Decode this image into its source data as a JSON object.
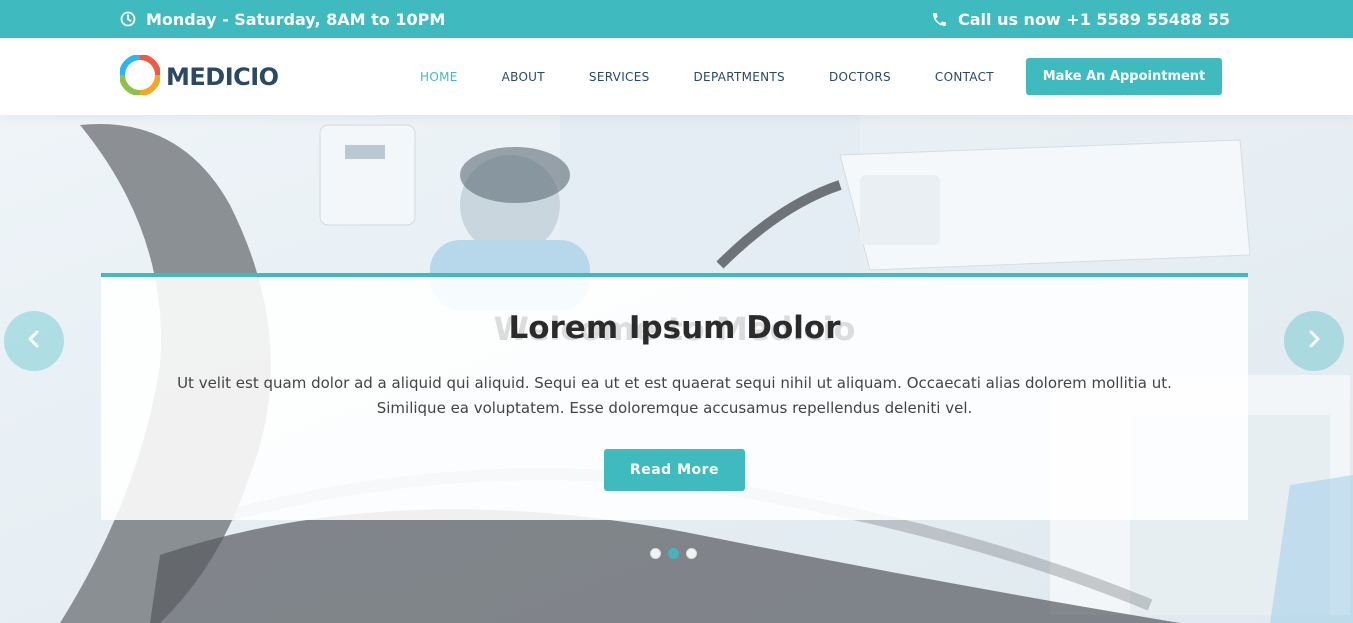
{
  "topbar": {
    "hours": "Monday - Saturday, 8AM to 10PM",
    "phone": "Call us now +1 5589 55488 55"
  },
  "header": {
    "logo_text": "MEDICIO",
    "nav": [
      "HOME",
      "ABOUT",
      "SERVICES",
      "DEPARTMENTS",
      "DOCTORS",
      "CONTACT"
    ],
    "active_nav": "HOME",
    "appointment_button": "Make An Appointment"
  },
  "hero": {
    "ghost_title": "Welcome to Medicio",
    "title": "Lorem Ipsum Dolor",
    "text_line1": "Ut velit est quam dolor ad a aliquid qui aliquid. Sequi ea ut et est quaerat sequi nihil ut aliquam. Occaecati alias dolorem mollitia ut.",
    "text_line2": "Similique ea voluptatem. Esse doloremque accusamus repellendus deleniti vel.",
    "button": "Read More",
    "slide_count": 3,
    "active_slide": 2
  },
  "colors": {
    "accent": "#3fbbc0",
    "dark": "#2c4964"
  },
  "icons": {
    "hours": "clock-icon",
    "phone": "phone-icon",
    "prev": "chevron-left-icon",
    "next": "chevron-right-icon"
  }
}
